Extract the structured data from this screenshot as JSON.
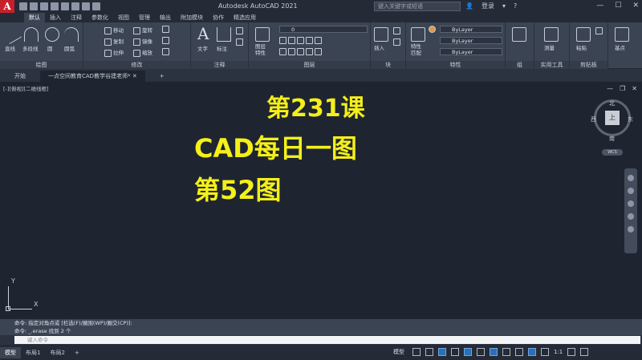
{
  "window": {
    "title": "Autodesk AutoCAD 2021",
    "search_placeholder": "键入关键字或短语",
    "login": "登录"
  },
  "menu_tabs": [
    "默认",
    "插入",
    "注释",
    "参数化",
    "视图",
    "管理",
    "输出",
    "附加模块",
    "协作",
    "精选应用"
  ],
  "ribbon": {
    "draw": {
      "title": "绘图",
      "line": "直线",
      "polyline": "多段线",
      "circle": "圆",
      "arc": "圆弧"
    },
    "modify": {
      "title": "修改",
      "move": "移动",
      "rotate": "旋转",
      "copy": "复制",
      "mirror": "镜像",
      "stretch": "拉伸",
      "scale": "缩放"
    },
    "annotation": {
      "title": "注释",
      "text": "文字",
      "dimension": "标注"
    },
    "layers": {
      "title": "图层",
      "layer_props": "图层\n特性",
      "current_layer": "0"
    },
    "block": {
      "title": "块",
      "insert": "插入"
    },
    "properties": {
      "title": "特性",
      "match": "特性\n匹配",
      "bylayer1": "ByLayer",
      "bylayer2": "ByLayer",
      "bylayer3": "ByLayer"
    },
    "groups": {
      "title": "组"
    },
    "utilities": {
      "title": "实用工具",
      "measure": "测量"
    },
    "clipboard": {
      "title": "剪贴板",
      "paste": "粘贴"
    },
    "base": {
      "label": "基点"
    }
  },
  "file_tabs": [
    "开始",
    "一点空间教育CAD教学谷建老师*"
  ],
  "viewport": {
    "label": "[-][俯视][二维线框]",
    "line1": "第231课",
    "line2": "CAD每日一图",
    "line3": "第52图",
    "text_color": "#f5ef1a"
  },
  "viewcube": {
    "north": "北",
    "south": "南",
    "east": "东",
    "west": "西",
    "face": "上",
    "wcs": "WCS"
  },
  "ucs": {
    "x": "X",
    "y": "Y"
  },
  "command": {
    "history1": "命令: 指定对角点或 [栏选(F)/圈围(WP)/圈交(CP)]:",
    "history2": "命令: _.erase 找到 2 个",
    "placeholder": "键入命令"
  },
  "layout_tabs": [
    "模型",
    "布局1",
    "布局2"
  ],
  "status": {
    "model": "模型",
    "scale": "1:1"
  }
}
